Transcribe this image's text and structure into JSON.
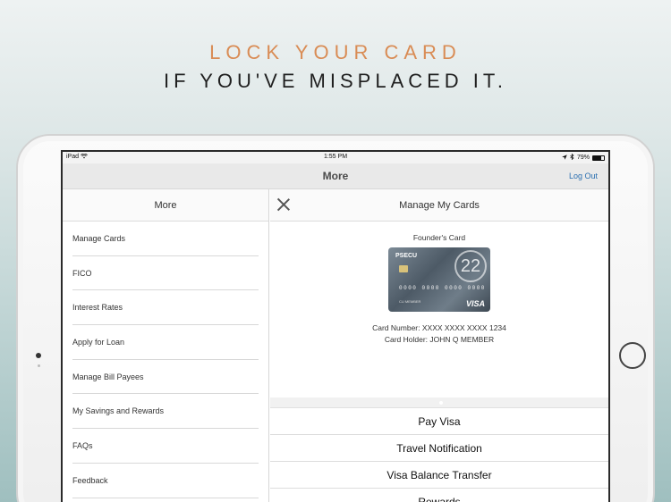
{
  "headline": {
    "line1": "LOCK YOUR CARD",
    "line2": "IF YOU'VE MISPLACED IT."
  },
  "status_bar": {
    "device": "iPad",
    "time": "1:55 PM",
    "battery": "79%",
    "battery_level": 0.79
  },
  "nav": {
    "title": "More",
    "logout": "Log Out"
  },
  "left_pane": {
    "title": "More",
    "items": [
      {
        "label": "Manage Cards"
      },
      {
        "label": "FICO"
      },
      {
        "label": "Interest Rates"
      },
      {
        "label": "Apply for Loan"
      },
      {
        "label": "Manage Bill Payees"
      },
      {
        "label": "My Savings and Rewards"
      },
      {
        "label": "FAQs"
      },
      {
        "label": "Feedback"
      }
    ]
  },
  "right_pane": {
    "title": "Manage My Cards",
    "card": {
      "name": "Founder's Card",
      "brand": "PSECU",
      "badge": "22",
      "digits": "0000 0000 0000 0000",
      "emboss_holder": "CU MEMBER",
      "network": "VISA",
      "number_text": "Card Number: XXXX XXXX XXXX 1234",
      "holder_text": "Card Holder: JOHN Q MEMBER"
    },
    "actions": [
      {
        "label": "Pay Visa"
      },
      {
        "label": "Travel Notification"
      },
      {
        "label": "Visa Balance Transfer"
      },
      {
        "label": "Rewards"
      }
    ]
  },
  "icons": {
    "wifi": "wifi-icon",
    "location": "location-arrow-icon",
    "bluetooth": "bluetooth-icon",
    "battery": "battery-icon",
    "close": "close-icon"
  },
  "colors": {
    "accent_orange": "#d98c55",
    "link_blue": "#2a6fb0"
  }
}
